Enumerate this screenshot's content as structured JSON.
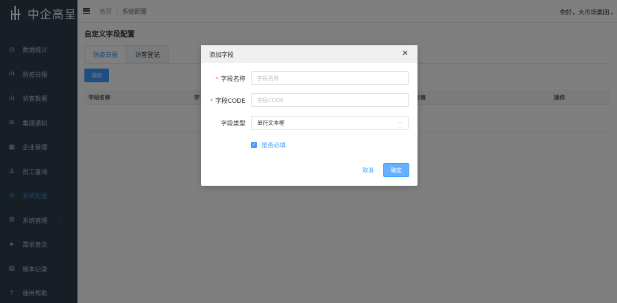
{
  "app": {
    "logo_text": "中企高呈"
  },
  "sidebar": {
    "items": [
      {
        "label": "数据统计",
        "icon": "clock-icon"
      },
      {
        "label": "防疫日报",
        "icon": "bar-chart-icon"
      },
      {
        "label": "访客数据",
        "icon": "bar-chart-icon"
      },
      {
        "label": "集团通知",
        "icon": "chat-icon"
      },
      {
        "label": "企业管理",
        "icon": "building-icon"
      },
      {
        "label": "员工查询",
        "icon": "user-icon"
      },
      {
        "label": "系统配置",
        "icon": "gear-icon",
        "active": true
      },
      {
        "label": "系统管理",
        "icon": "grid-icon",
        "has_submenu": true
      },
      {
        "label": "需求意见",
        "icon": "send-icon"
      },
      {
        "label": "版本记录",
        "icon": "document-icon"
      },
      {
        "label": "使用帮助",
        "icon": "help-icon"
      }
    ]
  },
  "header": {
    "breadcrumb": [
      "首页",
      "系统配置"
    ],
    "user_greeting": "你好，大市场集团"
  },
  "main": {
    "title": "自定义字段配置",
    "tabs": [
      {
        "label": "防疫日报",
        "active": true
      },
      {
        "label": "访客登记",
        "active": false
      }
    ],
    "add_button": "添加",
    "table_columns": [
      "字段名称",
      "字",
      "必填",
      "操作"
    ]
  },
  "modal": {
    "title": "添加字段",
    "fields": {
      "name": {
        "label": "字段名称",
        "placeholder": "字段名称",
        "required": true
      },
      "code": {
        "label": "字段CODE",
        "placeholder": "字段CODE",
        "required": true
      },
      "type": {
        "label": "字段类型",
        "value": "单行文本框",
        "required": false
      }
    },
    "required_checkbox": {
      "label": "是否必填",
      "checked": true
    },
    "cancel_label": "取消",
    "ok_label": "确定"
  },
  "colors": {
    "primary": "#409eff",
    "sidebar_bg": "#2f3d4d",
    "required": "#f56c6c"
  }
}
